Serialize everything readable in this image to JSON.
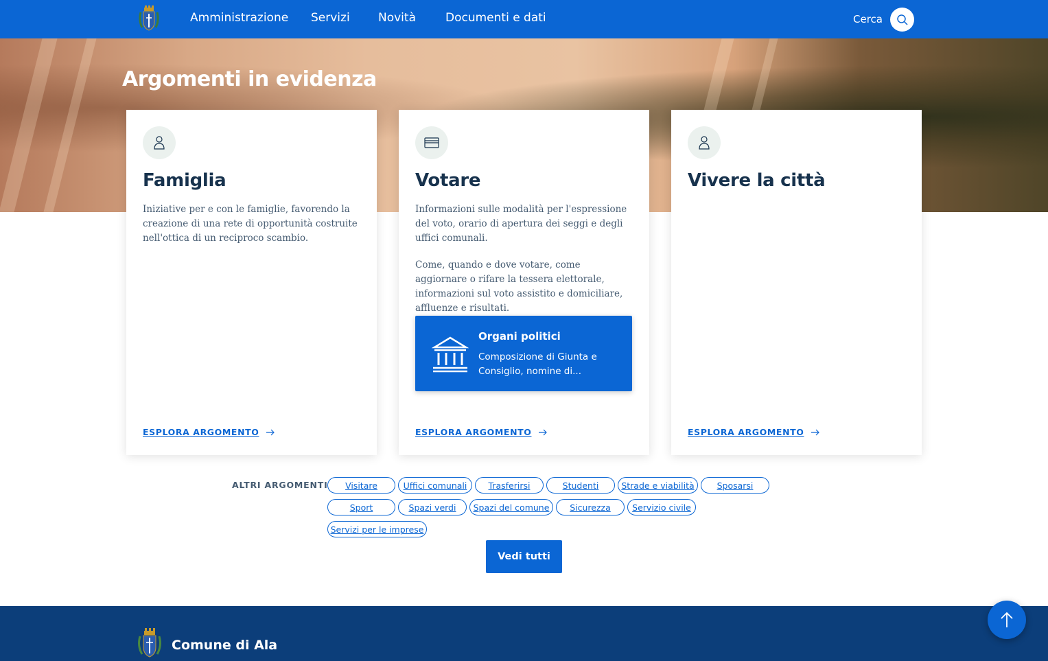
{
  "header": {
    "nav": [
      "Amministrazione",
      "Servizi",
      "Novità",
      "Documenti e dati"
    ],
    "search_label": "Cerca"
  },
  "hero": {
    "title": "Argomenti in evidenza"
  },
  "cards": [
    {
      "title": "Famiglia",
      "description": "Iniziative per e con le famiglie, favorendo la creazione di una rete di opportunità costruite nell'ottica di un reciproco scambio.",
      "link": "ESPLORA ARGOMENTO",
      "icon": "user-icon"
    },
    {
      "title": "Votare",
      "description": "Informazioni sulle modalità per l'espressione del voto, orario di apertura dei seggi e degli uffici comunali.",
      "description2": "Come, quando e dove votare, come aggiornare o rifare la tessera elettorale, informazioni sul voto assistito e domiciliare, affluenze e risultati.",
      "link": "ESPLORA ARGOMENTO",
      "icon": "card-icon",
      "featured": {
        "title": "Organi politici",
        "text": "Composizione di Giunta e Consiglio, nomine di..."
      }
    },
    {
      "title": "Vivere la città",
      "link": "ESPLORA ARGOMENTO",
      "icon": "user-icon"
    }
  ],
  "altri": {
    "label": "ALTRI ARGOMENTI",
    "chips": [
      "Visitare",
      "Uffici comunali",
      "Trasferirsi",
      "Studenti",
      "Strade e viabilità",
      "Sposarsi",
      "Sport",
      "Spazi verdi",
      "Spazi del comune",
      "Sicurezza",
      "Servizio civile",
      "Servizi per le imprese"
    ],
    "see_all": "Vedi tutti"
  },
  "footer": {
    "title": "Comune di Ala"
  },
  "colors": {
    "primary": "#0b66d4",
    "footer": "#0c3e7a",
    "heading": "#17324d"
  }
}
